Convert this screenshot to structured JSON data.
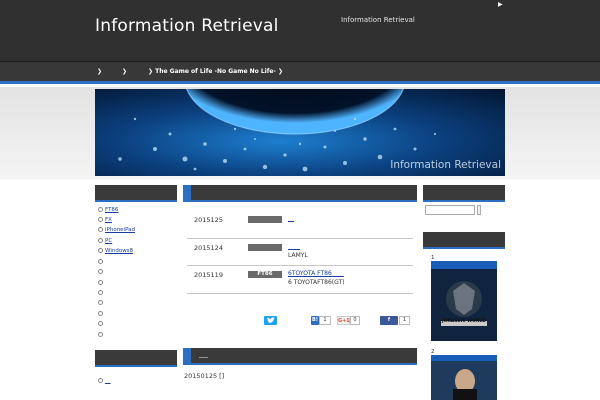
{
  "header": {
    "site_title": "Information Retrieval",
    "description": "Information Retrieval",
    "corner_link": "▶"
  },
  "nav": {
    "items": [
      {
        "label": "❯"
      },
      {
        "label": "❯"
      },
      {
        "label": "❯  The Game of Life -No Game No Life-"
      },
      {
        "label": "❯"
      }
    ]
  },
  "banner": {
    "caption": "Information Retrieval"
  },
  "sidebar_left": {
    "categories": [
      {
        "label": "FT86"
      },
      {
        "label": "FX"
      },
      {
        "label": "iPhoneiPad"
      },
      {
        "label": "PC"
      },
      {
        "label": "Windows8"
      }
    ],
    "lower_link": "__"
  },
  "posts": [
    {
      "date": "2015125",
      "tag": "",
      "link": "__",
      "sub": ""
    },
    {
      "date": "2015124",
      "tag": "",
      "link": "____",
      "sub": "LAMYL"
    },
    {
      "date": "2015119",
      "tag": "FT86",
      "link": "6TOYOTA FT86____",
      "sub": "6 TOYOTAFT86(GT)"
    }
  ],
  "share": {
    "hatena_label": "B!",
    "hatena_count": "1",
    "gplus_label": "G+1",
    "gplus_count": "0",
    "facebook_label": "f",
    "facebook_count": "1"
  },
  "main_lower": {
    "heading": "___",
    "date_text": "20150125 []"
  },
  "sidebar_right": {
    "ranking": [
      {
        "rank": "1",
        "cover_text": "JURASSIC WORLD"
      },
      {
        "rank": "2",
        "cover_text": ""
      }
    ]
  },
  "colors": {
    "accent": "#2c6fc2",
    "header_bg": "#303030",
    "link": "#1a3c9e"
  }
}
